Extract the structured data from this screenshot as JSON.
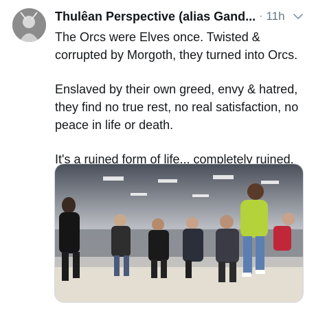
{
  "tweet": {
    "author_name": "Thulêan Perspective (alias Gand...",
    "separator": "·",
    "timestamp": "11h",
    "paragraphs": [
      "The Orcs were Elves once. Twisted & corrupted by Morgoth, they turned into Orcs.",
      "Enslaved by their own greed, envy & hatred, they find no true rest, no real satisfaction, no peace in life or death.",
      "It's a ruined form of life... completely ruined."
    ]
  },
  "icons": {
    "avatar": "avatar-image",
    "menu": "chevron-down-icon"
  },
  "colors": {
    "text": "#14171a",
    "muted": "#657786"
  }
}
